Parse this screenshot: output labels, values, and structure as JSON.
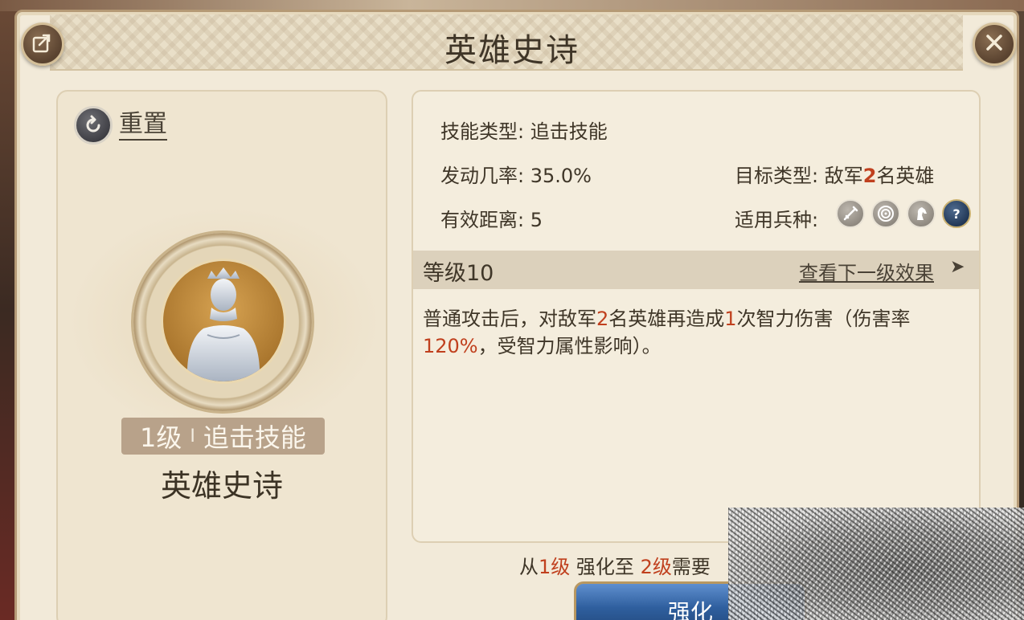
{
  "title": "英雄史诗",
  "reset": {
    "label": "重置"
  },
  "hero": {
    "level_badge_num": "1级",
    "level_badge_sep": "I",
    "level_badge_type": "追击技能",
    "name": "英雄史诗"
  },
  "stats": {
    "skill_type_label": "技能类型:",
    "skill_type_value": "追击技能",
    "trigger_rate_label": "发动几率:",
    "trigger_rate_value": "35.0%",
    "range_label": "有效距离:",
    "range_value": "5",
    "target_type_label": "目标类型:",
    "target_type_prefix": "敌军",
    "target_type_count": "2",
    "target_type_suffix": "名英雄",
    "troop_types_label": "适用兵种:",
    "troop_icons": [
      "sword-icon",
      "bow-target-icon",
      "horse-icon",
      "question-icon"
    ]
  },
  "level_section": {
    "level_text": "等级10",
    "next_effect_link": "查看下一级效果",
    "arrow": "➤"
  },
  "description": {
    "part1": "普通攻击后，对敌军",
    "num1": "2",
    "part2": "名英雄再造成",
    "num2": "1",
    "part3": "次智力伤害（伤害率",
    "num3": "120%",
    "part4": "，受智力属性影响）。"
  },
  "upgrade": {
    "from_word": "从",
    "from_level": "1级",
    "mid_word": "强化至",
    "to_level": "2级",
    "need_word": "需要",
    "button_label": "强化"
  },
  "colors": {
    "highlight": "#c0401e",
    "panel_bg": "#f2ead9",
    "button_blue": "#2f5f9e"
  }
}
